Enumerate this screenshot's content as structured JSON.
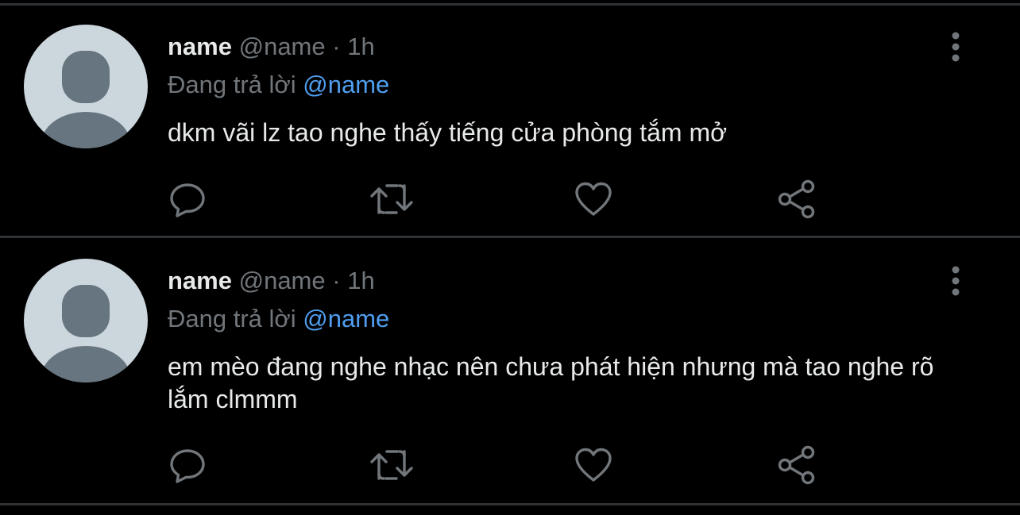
{
  "tweets": [
    {
      "name": "name",
      "handle": "@name",
      "separator": "·",
      "time": "1h",
      "replying_prefix": "Đang trả lời",
      "replying_to": "@name",
      "text": "dkm vãi lz tao nghe thấy tiếng cửa phòng tắm mở"
    },
    {
      "name": "name",
      "handle": "@name",
      "separator": "·",
      "time": "1h",
      "replying_prefix": "Đang trả lời",
      "replying_to": "@name",
      "text": "em mèo đang nghe nhạc nên chưa phát hiện nhưng mà tao nghe rõ lắm clmmm"
    }
  ],
  "icons": {
    "reply": "reply-icon",
    "retweet": "retweet-icon",
    "like": "like-icon",
    "share": "share-icon",
    "more": "more-options-icon",
    "avatar": "default-avatar-icon"
  },
  "colors": {
    "background": "#000000",
    "text": "#e7e9ea",
    "muted": "#71767b",
    "mention": "#4f9ef0",
    "divider": "#2f3336",
    "avatar_bg": "#ccd6dd",
    "avatar_fg": "#66757f"
  }
}
